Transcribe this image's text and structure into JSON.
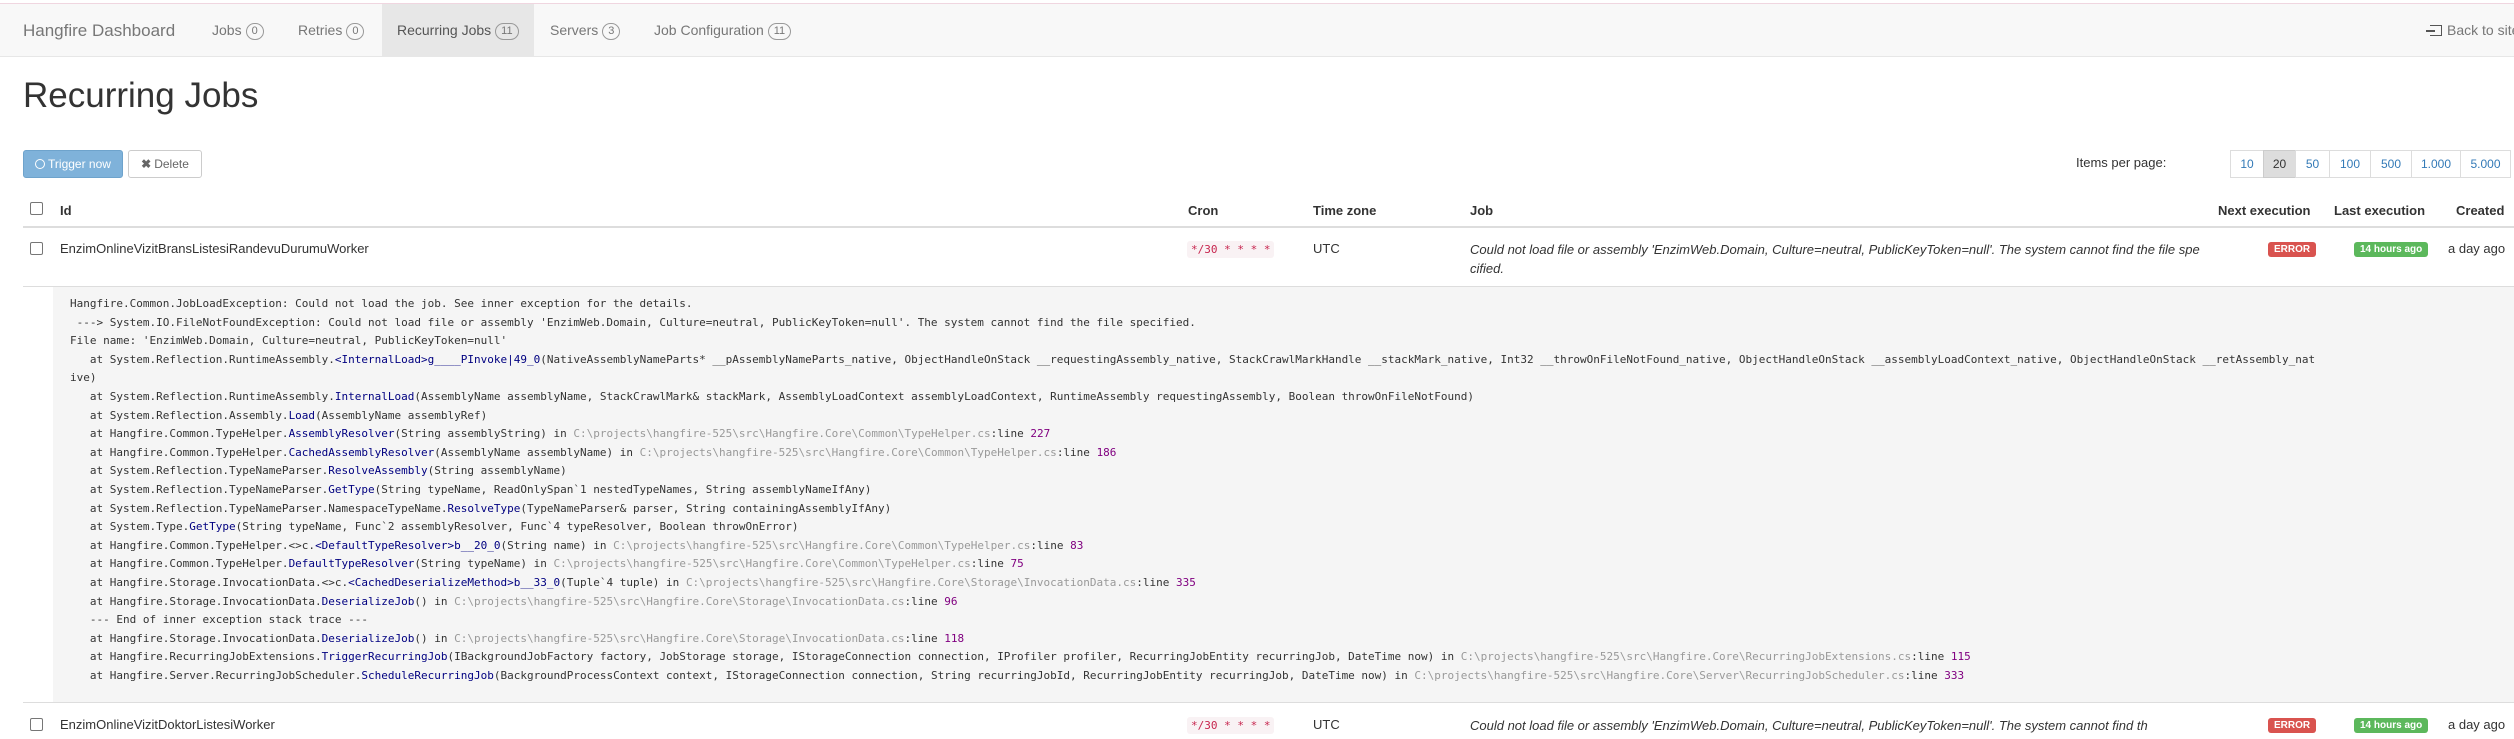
{
  "nav": {
    "brand": "Hangfire Dashboard",
    "items": [
      {
        "label": "Jobs",
        "count": "0"
      },
      {
        "label": "Retries",
        "count": "0"
      },
      {
        "label": "Recurring Jobs",
        "count": "11"
      },
      {
        "label": "Servers",
        "count": "3"
      },
      {
        "label": "Job Configuration",
        "count": "11"
      }
    ],
    "back": "Back to site"
  },
  "page": {
    "title": "Recurring Jobs"
  },
  "toolbar": {
    "trigger_label": "Trigger now",
    "delete_label": "Delete",
    "items_per_page_label": "Items per page:",
    "page_sizes": [
      "10",
      "20",
      "50",
      "100",
      "500",
      "1.000",
      "5.000"
    ],
    "selected_page_size": "20"
  },
  "table": {
    "headers": {
      "id": "Id",
      "cron": "Cron",
      "timezone": "Time zone",
      "job": "Job",
      "next": "Next execution",
      "last": "Last execution",
      "created": "Created"
    },
    "rows": [
      {
        "id": "EnzimOnlineVizitBransListesiRandevuDurumuWorker",
        "cron": "*/30 * * * *",
        "timezone": "UTC",
        "job": "Could not load file or assembly 'EnzimWeb.Domain, Culture=neutral, PublicKeyToken=null'. The system cannot find the file specified.",
        "next": "ERROR",
        "last": "14 hours ago",
        "created": "a day ago"
      },
      {
        "id": "EnzimOnlineVizitDoktorListesiWorker",
        "cron": "*/30 * * * *",
        "timezone": "UTC",
        "job": "Could not load file or assembly 'EnzimWeb.Domain, Culture=neutral, PublicKeyToken=null'. The system cannot find th",
        "next": "ERROR",
        "last": "14 hours ago",
        "created": "a day ago"
      }
    ]
  },
  "stacktrace": {
    "header": [
      "Hangfire.Common.JobLoadException: Could not load the job. See inner exception for the details.",
      " ---> System.IO.FileNotFoundException: Could not load file or assembly 'EnzimWeb.Domain, Culture=neutral, PublicKeyToken=null'. The system cannot find the file specified.",
      "File name: 'EnzimWeb.Domain, Culture=neutral, PublicKeyToken=null'"
    ],
    "frames": [
      {
        "type": "System.Reflection.RuntimeAssembly.",
        "method": "<InternalLoad>g____PInvoke|49_0",
        "args": "(NativeAssemblyNameParts* __pAssemblyNameParts_native, ObjectHandleOnStack __requestingAssembly_native, StackCrawlMarkHandle __stackMark_native, Int32 __throwOnFileNotFound_native, ObjectHandleOnStack __assemblyLoadContext_native, ObjectHandleOnStack __retAssembly_nat",
        "file": "",
        "line": ""
      },
      {
        "type": "",
        "method": "",
        "args": "ive)",
        "file": "",
        "line": "",
        "wrap": true
      },
      {
        "type": "System.Reflection.RuntimeAssembly.",
        "method": "InternalLoad",
        "args": "(AssemblyName assemblyName, StackCrawlMark& stackMark, AssemblyLoadContext assemblyLoadContext, RuntimeAssembly requestingAssembly, Boolean throwOnFileNotFound)",
        "file": "",
        "line": ""
      },
      {
        "type": "System.Reflection.Assembly.",
        "method": "Load",
        "args": "(AssemblyName assemblyRef)",
        "file": "",
        "line": ""
      },
      {
        "type": "Hangfire.Common.TypeHelper.",
        "method": "AssemblyResolver",
        "args": "(String assemblyString)",
        "file": "C:\\projects\\hangfire-525\\src\\Hangfire.Core\\Common\\TypeHelper.cs",
        "line": "227"
      },
      {
        "type": "Hangfire.Common.TypeHelper.",
        "method": "CachedAssemblyResolver",
        "args": "(AssemblyName assemblyName)",
        "file": "C:\\projects\\hangfire-525\\src\\Hangfire.Core\\Common\\TypeHelper.cs",
        "line": "186"
      },
      {
        "type": "System.Reflection.TypeNameParser.",
        "method": "ResolveAssembly",
        "args": "(String assemblyName)",
        "file": "",
        "line": ""
      },
      {
        "type": "System.Reflection.TypeNameParser.",
        "method": "GetType",
        "args": "(String typeName, ReadOnlySpan`1 nestedTypeNames, String assemblyNameIfAny)",
        "file": "",
        "line": ""
      },
      {
        "type": "System.Reflection.TypeNameParser.NamespaceTypeName.",
        "method": "ResolveType",
        "args": "(TypeNameParser& parser, String containingAssemblyIfAny)",
        "file": "",
        "line": ""
      },
      {
        "type": "System.Type.",
        "method": "GetType",
        "args": "(String typeName, Func`2 assemblyResolver, Func`4 typeResolver, Boolean throwOnError)",
        "file": "",
        "line": ""
      },
      {
        "type": "Hangfire.Common.TypeHelper.<>c.",
        "method": "<DefaultTypeResolver>b__20_0",
        "args": "(String name)",
        "file": "C:\\projects\\hangfire-525\\src\\Hangfire.Core\\Common\\TypeHelper.cs",
        "line": "83"
      },
      {
        "type": "Hangfire.Common.TypeHelper.",
        "method": "DefaultTypeResolver",
        "args": "(String typeName)",
        "file": "C:\\projects\\hangfire-525\\src\\Hangfire.Core\\Common\\TypeHelper.cs",
        "line": "75"
      },
      {
        "type": "Hangfire.Storage.InvocationData.<>c.",
        "method": "<CachedDeserializeMethod>b__33_0",
        "args": "(Tuple`4 tuple)",
        "file": "C:\\projects\\hangfire-525\\src\\Hangfire.Core\\Storage\\InvocationData.cs",
        "line": "335"
      },
      {
        "type": "Hangfire.Storage.InvocationData.",
        "method": "DeserializeJob",
        "args": "()",
        "file": "C:\\projects\\hangfire-525\\src\\Hangfire.Core\\Storage\\InvocationData.cs",
        "line": "96"
      },
      {
        "type": "",
        "method": "",
        "args": "--- End of inner exception stack trace ---",
        "file": "",
        "line": "",
        "plain": true
      },
      {
        "type": "Hangfire.Storage.InvocationData.",
        "method": "DeserializeJob",
        "args": "()",
        "file": "C:\\projects\\hangfire-525\\src\\Hangfire.Core\\Storage\\InvocationData.cs",
        "line": "118"
      },
      {
        "type": "Hangfire.RecurringJobExtensions.",
        "method": "TriggerRecurringJob",
        "args": "(IBackgroundJobFactory factory, JobStorage storage, IStorageConnection connection, IProfiler profiler, RecurringJobEntity recurringJob, DateTime now)",
        "file": "C:\\projects\\hangfire-525\\src\\Hangfire.Core\\RecurringJobExtensions.cs",
        "line": "115"
      },
      {
        "type": "Hangfire.Server.RecurringJobScheduler.",
        "method": "ScheduleRecurringJob",
        "args": "(BackgroundProcessContext context, IStorageConnection connection, String recurringJobId, RecurringJobEntity recurringJob, DateTime now)",
        "file": "C:\\projects\\hangfire-525\\src\\Hangfire.Core\\Server\\RecurringJobScheduler.cs",
        "line": "333"
      }
    ]
  }
}
